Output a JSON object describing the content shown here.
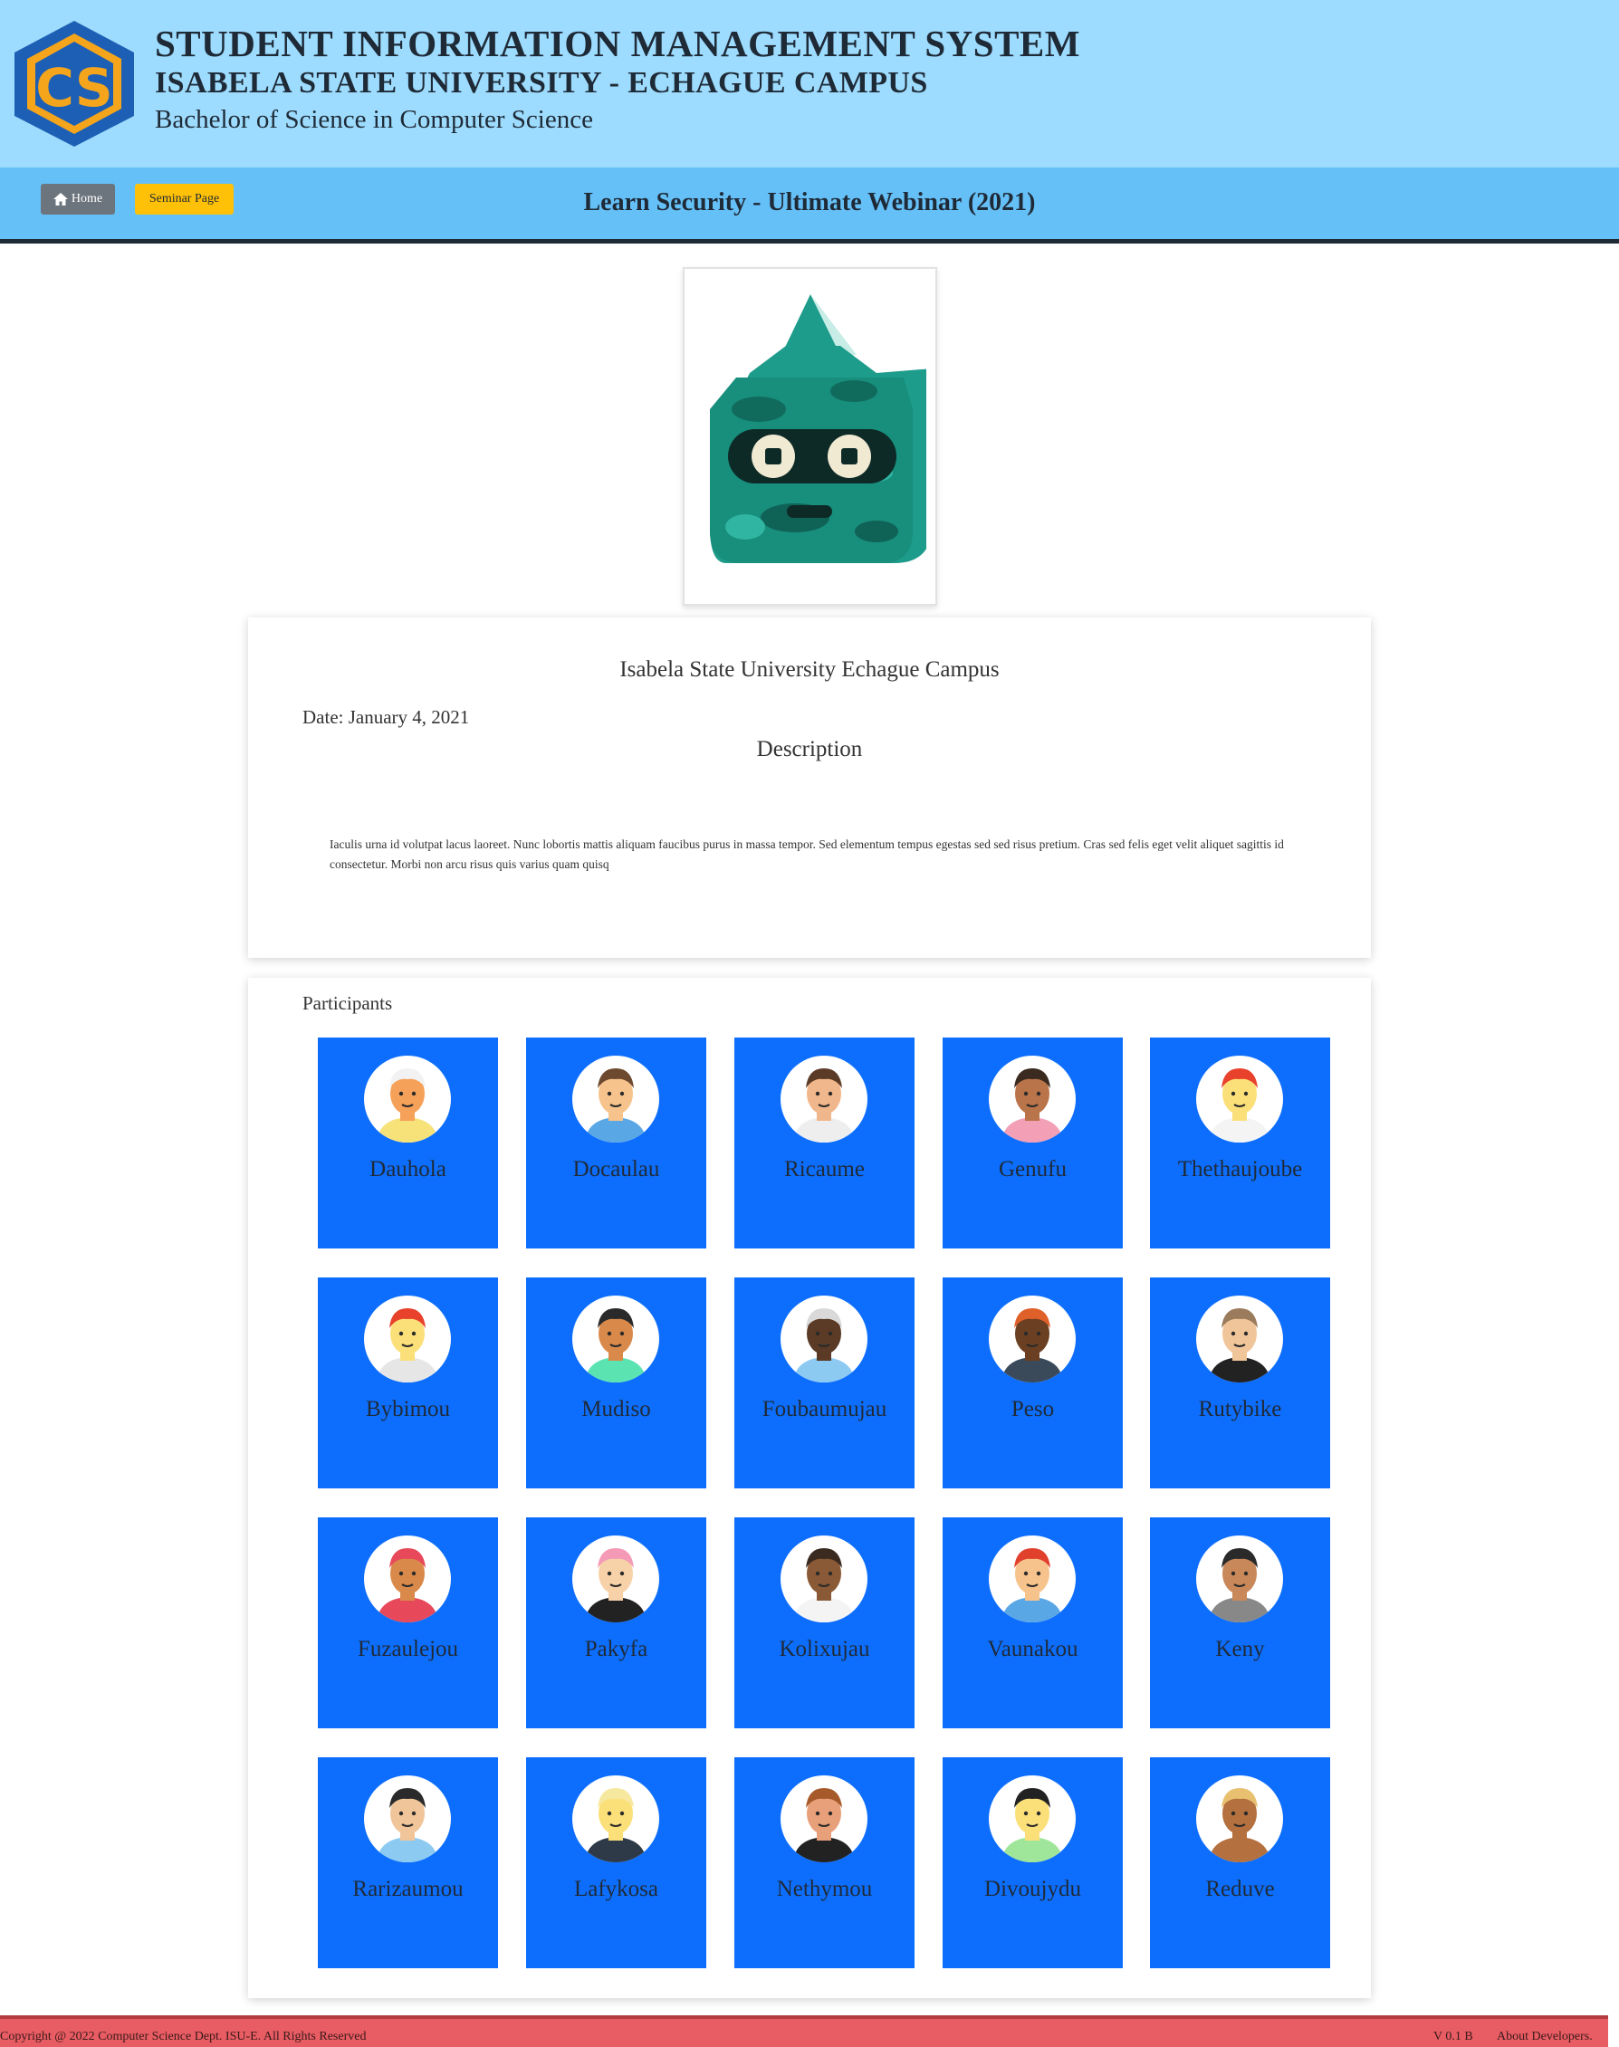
{
  "header": {
    "title": "STUDENT INFORMATION MANAGEMENT SYSTEM",
    "subtitle": "ISABELA STATE UNIVERSITY - ECHAGUE CAMPUS",
    "program": "Bachelor of Science in Computer Science",
    "logo_text": "CS"
  },
  "nav": {
    "home_label": "Home",
    "home_icon": "home-icon",
    "seminar_label": "Seminar Page",
    "page_title": "Learn Security - Ultimate Webinar (2021)"
  },
  "event": {
    "organizer": "Isabela State University Echague Campus",
    "date": "Date: January 4, 2021",
    "description_title": "Description",
    "description": "Iaculis urna id volutpat lacus laoreet. Nunc lobortis mattis aliquam faucibus purus in massa tempor. Sed elementum tempus egestas sed sed risus pretium. Cras sed felis eget velit aliquet sagittis id consectetur. Morbi non arcu risus quis varius quam quisq"
  },
  "participants": {
    "label": "Participants",
    "items": [
      {
        "name": "Dauhola",
        "skin": "#f5a15a",
        "hair": "#f2f2f2",
        "shirt": "#f7e27a"
      },
      {
        "name": "Docaulau",
        "skin": "#f7c38d",
        "hair": "#6d4a2f",
        "shirt": "#5aa7e6"
      },
      {
        "name": "Ricaume",
        "skin": "#f1b78c",
        "hair": "#5b3a26",
        "shirt": "#eeeeee"
      },
      {
        "name": "Genufu",
        "skin": "#b9744a",
        "hair": "#3a2a20",
        "shirt": "#f39fb5"
      },
      {
        "name": "Thethaujoube",
        "skin": "#fbe07a",
        "hair": "#e8412c",
        "shirt": "#f4f4f4"
      },
      {
        "name": "Bybimou",
        "skin": "#fbe07a",
        "hair": "#e8412c",
        "shirt": "#e6e6e6"
      },
      {
        "name": "Mudiso",
        "skin": "#d98a4b",
        "hair": "#2a2a2a",
        "shirt": "#5be3b2"
      },
      {
        "name": "Foubaumujau",
        "skin": "#5b3a26",
        "hair": "#d9d9d9",
        "shirt": "#8ccaf2"
      },
      {
        "name": "Peso",
        "skin": "#6b3f22",
        "hair": "#e0602a",
        "shirt": "#3b4a5a"
      },
      {
        "name": "Rutybike",
        "skin": "#f1c59a",
        "hair": "#9a7b5c",
        "shirt": "#222222"
      },
      {
        "name": "Fuzaulejou",
        "skin": "#d98a4b",
        "hair": "#e8495a",
        "shirt": "#e8495a"
      },
      {
        "name": "Pakyfa",
        "skin": "#f7d2a8",
        "hair": "#f59ab6",
        "shirt": "#222222"
      },
      {
        "name": "Kolixujau",
        "skin": "#8a5a36",
        "hair": "#3a2a20",
        "shirt": "#f4f4f4"
      },
      {
        "name": "Vaunakou",
        "skin": "#f7c38d",
        "hair": "#e0402c",
        "shirt": "#5aa7e6"
      },
      {
        "name": "Keny",
        "skin": "#c9885a",
        "hair": "#2a2a2a",
        "shirt": "#888888"
      },
      {
        "name": "Rarizaumou",
        "skin": "#f1c59a",
        "hair": "#2a2a2a",
        "shirt": "#8ccaf2"
      },
      {
        "name": "Lafykosa",
        "skin": "#fbe07a",
        "hair": "#f7e8a0",
        "shirt": "#2e3a48"
      },
      {
        "name": "Nethymou",
        "skin": "#e8a07a",
        "hair": "#a65a2a",
        "shirt": "#222222"
      },
      {
        "name": "Divoujydu",
        "skin": "#fbe07a",
        "hair": "#222222",
        "shirt": "#9fe59a"
      },
      {
        "name": "Reduve",
        "skin": "#b4703e",
        "hair": "#e8c070",
        "shirt": "#b4703e"
      }
    ]
  },
  "footer": {
    "copyright": "Copyright @ 2022 Computer Science Dept. ISU-E. All Rights Reserved",
    "version": "V 0.1 B",
    "about": "About Developers."
  }
}
